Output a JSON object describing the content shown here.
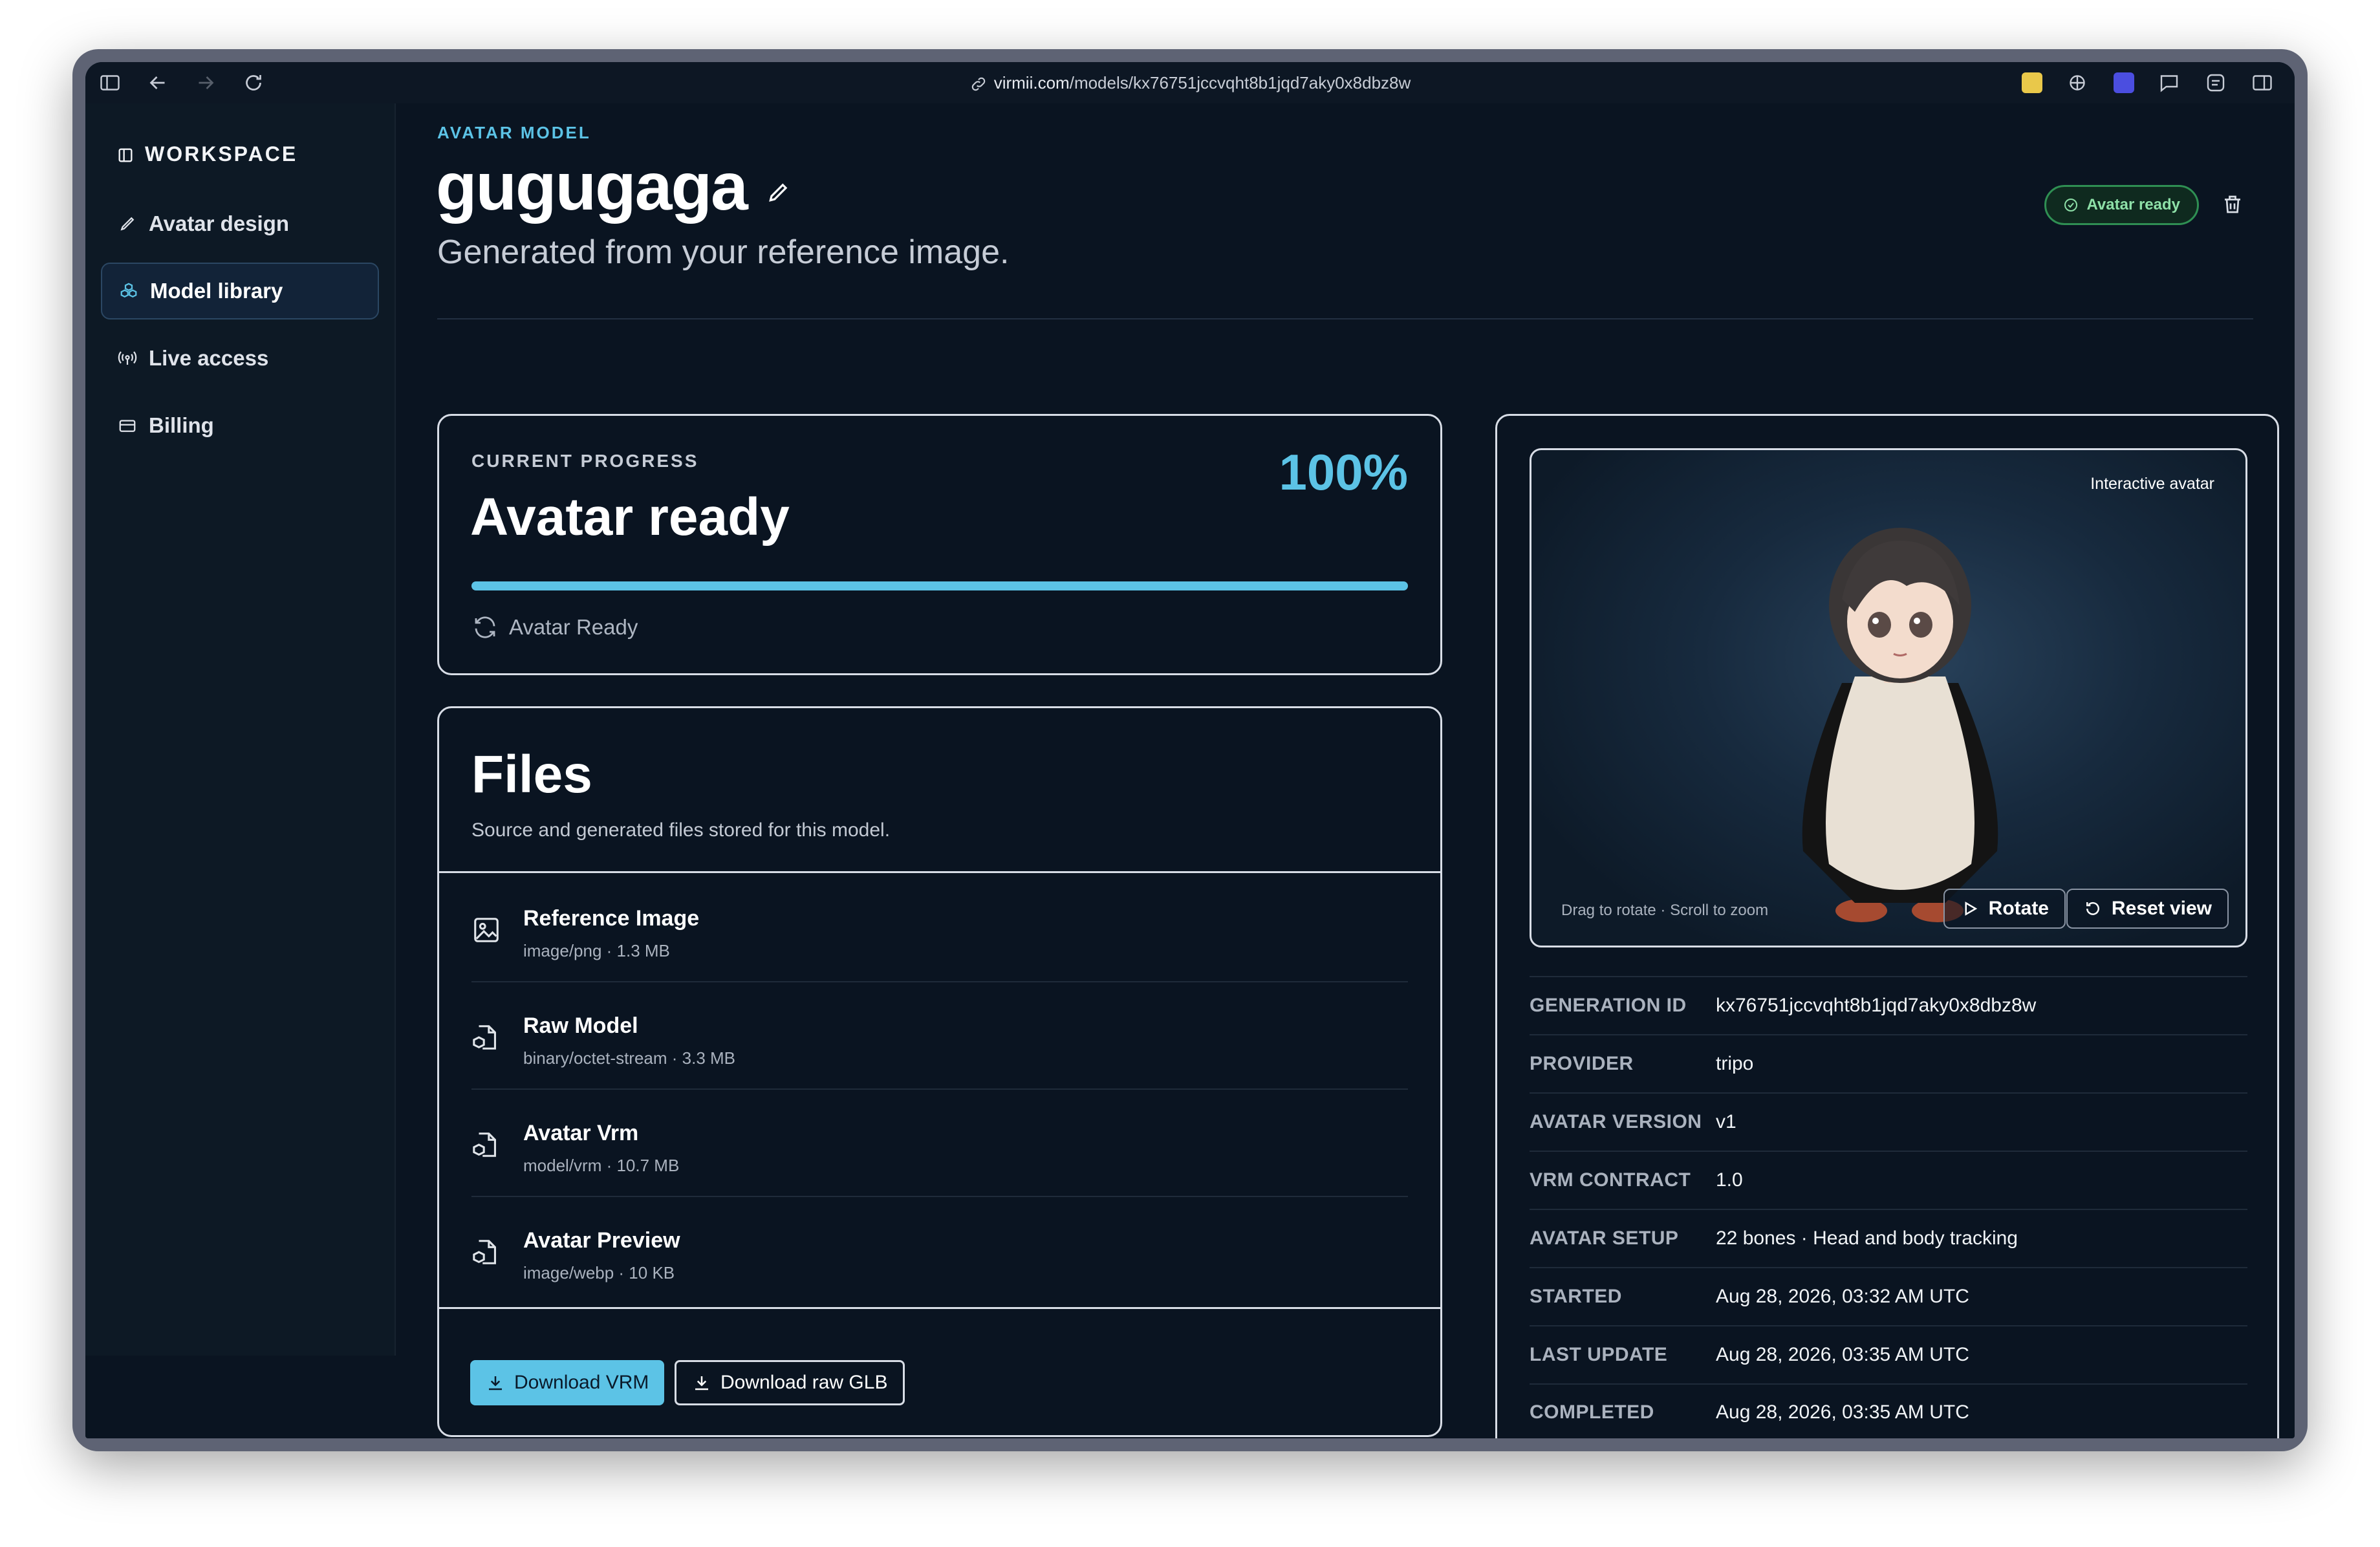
{
  "browser": {
    "url_host": "virmii.com",
    "url_path": "/models/kx76751jccvqht8b1jqd7aky0x8dbz8w"
  },
  "sidebar": {
    "title": "WORKSPACE",
    "items": [
      {
        "label": "Avatar design",
        "icon": "brush-icon"
      },
      {
        "label": "Model library",
        "icon": "cubes-icon",
        "active": true
      },
      {
        "label": "Live access",
        "icon": "broadcast-icon"
      },
      {
        "label": "Billing",
        "icon": "card-icon"
      }
    ]
  },
  "header": {
    "eyebrow": "AVATAR MODEL",
    "title": "gugugaga",
    "subtitle": "Generated from your reference image.",
    "status_pill": "Avatar ready"
  },
  "progress": {
    "label": "CURRENT PROGRESS",
    "percent_text": "100%",
    "percent": 100,
    "status": "Avatar ready",
    "substatus": "Avatar Ready"
  },
  "files": {
    "title": "Files",
    "description": "Source and generated files stored for this model.",
    "items": [
      {
        "name": "Reference Image",
        "meta": "image/png · 1.3 MB",
        "icon": "image-icon"
      },
      {
        "name": "Raw Model",
        "meta": "binary/octet-stream · 3.3 MB",
        "icon": "file-model-icon"
      },
      {
        "name": "Avatar Vrm",
        "meta": "model/vrm · 10.7 MB",
        "icon": "file-model-icon"
      },
      {
        "name": "Avatar Preview",
        "meta": "image/webp · 10 KB",
        "icon": "file-model-icon"
      }
    ],
    "download_vrm": "Download VRM",
    "download_glb": "Download raw GLB"
  },
  "viewer": {
    "label": "Interactive avatar",
    "hint": "Drag to rotate · Scroll to zoom",
    "rotate": "Rotate",
    "reset": "Reset view"
  },
  "details": [
    {
      "key": "GENERATION ID",
      "value": "kx76751jccvqht8b1jqd7aky0x8dbz8w"
    },
    {
      "key": "PROVIDER",
      "value": "tripo"
    },
    {
      "key": "AVATAR VERSION",
      "value": "v1"
    },
    {
      "key": "VRM CONTRACT",
      "value": "1.0"
    },
    {
      "key": "AVATAR SETUP",
      "value": "22 bones · Head and body tracking"
    },
    {
      "key": "STARTED",
      "value": "Aug 28, 2026, 03:32 AM UTC"
    },
    {
      "key": "LAST UPDATE",
      "value": "Aug 28, 2026, 03:35 AM UTC"
    },
    {
      "key": "COMPLETED",
      "value": "Aug 28, 2026, 03:35 AM UTC"
    }
  ],
  "colors": {
    "accent": "#5cc3e6",
    "success": "#2f8f53",
    "background": "#0a1421"
  }
}
